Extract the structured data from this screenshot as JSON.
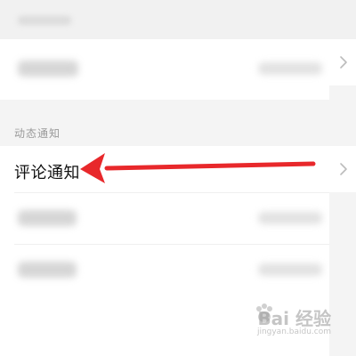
{
  "section": {
    "title": "动态通知"
  },
  "highlighted_row": {
    "label": "评论通知"
  },
  "annotation": {
    "arrow_color": "#e8282b"
  },
  "watermark": {
    "brand": "Bai  经验",
    "sub": "jingyan.baidu.com"
  },
  "icons": {
    "chevron": "chevron-right-icon",
    "watermark_logo": "baidu-paw-icon"
  }
}
